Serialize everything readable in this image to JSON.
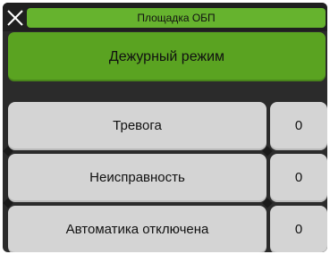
{
  "header": {
    "title": "Площадка ОБП",
    "close_icon": "close-icon"
  },
  "mode": {
    "label": "Дежурный режим"
  },
  "rows": [
    {
      "label": "Тревога",
      "value": "0"
    },
    {
      "label": "Неисправность",
      "value": "0"
    },
    {
      "label": "Автоматика отключена",
      "value": "0"
    }
  ],
  "colors": {
    "title_bar": "#66b32e",
    "mode_button": "#5aa321",
    "row_button": "#d4d4d4",
    "background": "#2b2b2b"
  }
}
